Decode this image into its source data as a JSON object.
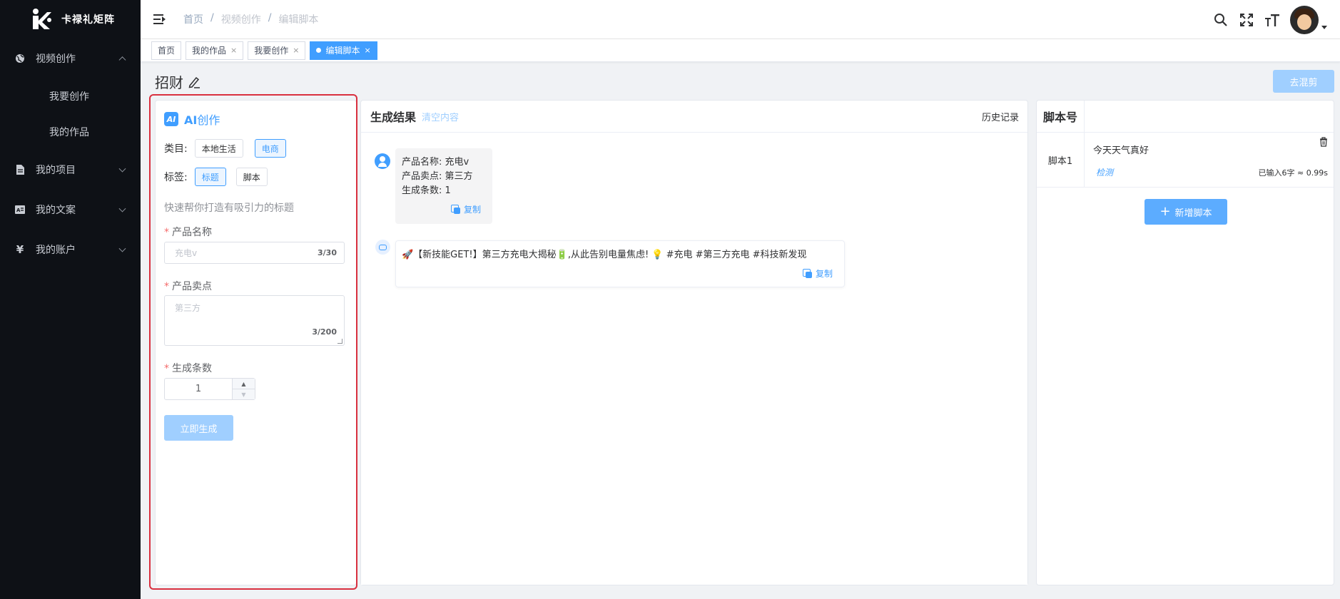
{
  "app": {
    "name": "卡禄礼矩阵"
  },
  "sidebar": {
    "menus": [
      {
        "label": "视频创作",
        "icon": "globe-icon",
        "expanded": true,
        "children": [
          {
            "label": "我要创作"
          },
          {
            "label": "我的作品"
          }
        ]
      },
      {
        "label": "我的项目",
        "icon": "document-icon",
        "expanded": false
      },
      {
        "label": "我的文案",
        "icon": "text-card-icon",
        "expanded": false
      },
      {
        "label": "我的账户",
        "icon": "yen-icon",
        "expanded": false
      }
    ]
  },
  "header": {
    "breadcrumb": [
      "首页",
      "视频创作",
      "编辑脚本"
    ]
  },
  "tags": [
    {
      "label": "首页",
      "closable": false,
      "active": false
    },
    {
      "label": "我的作品",
      "closable": true,
      "active": false
    },
    {
      "label": "我要创作",
      "closable": true,
      "active": false
    },
    {
      "label": "编辑脚本",
      "closable": true,
      "active": true
    }
  ],
  "page": {
    "title": "招财",
    "go_button": "去混剪"
  },
  "ai_panel": {
    "badge": "AI",
    "title_prefix": "AI",
    "title_suffix": "创作",
    "category_label": "类目:",
    "categories": [
      {
        "label": "本地生活",
        "selected": false
      },
      {
        "label": "电商",
        "selected": true
      }
    ],
    "tag_label": "标签:",
    "tags": [
      {
        "label": "标题",
        "selected": true
      },
      {
        "label": "脚本",
        "selected": false
      }
    ],
    "hint": "快速帮你打造有吸引力的标题",
    "product_name": {
      "label": "产品名称",
      "value": "充电v",
      "count": "3/30"
    },
    "selling_point": {
      "label": "产品卖点",
      "value": "第三方",
      "count": "3/200"
    },
    "gen_count": {
      "label": "生成条数",
      "value": "1"
    },
    "generate_button": "立即生成"
  },
  "results": {
    "title": "生成结果",
    "clear": "清空内容",
    "history": "历史记录",
    "user_message": {
      "line1": "产品名称: 充电v",
      "line2": "产品卖点: 第三方",
      "line3": "生成条数: 1"
    },
    "bot_message": "🚀【新技能GET!】第三方充电大揭秘🔋,从此告别电量焦虑! 💡 #充电 #第三方充电 #科技新发现",
    "copy": "复制"
  },
  "scripts": {
    "header": "脚本号",
    "rows": [
      {
        "label": "脚本1",
        "text": "今天天气真好",
        "detect": "检测",
        "stat": "已输入6字 ≈ 0.99s"
      }
    ],
    "add_button": "新增脚本"
  },
  "colors": {
    "accent": "#409eff",
    "sidebar_bg": "#0e1116",
    "highlight_outline": "#d9303f"
  }
}
